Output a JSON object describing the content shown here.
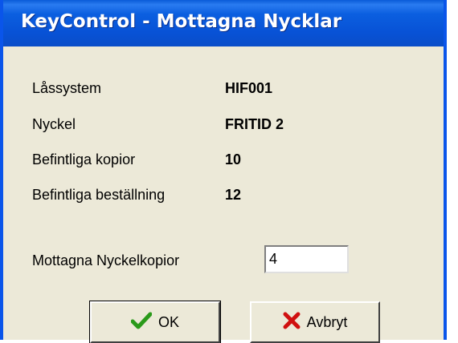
{
  "window": {
    "title": "KeyControl - Mottagna Nycklar"
  },
  "fields": {
    "lassystem_label": "Låssystem",
    "lassystem_value": "HIF001",
    "nyckel_label": "Nyckel",
    "nyckel_value": "FRITID 2",
    "befintliga_kopior_label": "Befintliga kopior",
    "befintliga_kopior_value": "10",
    "befintliga_bestallning_label": "Befintliga beställning",
    "befintliga_bestallning_value": "12",
    "mottagna_label": "Mottagna Nyckelkopior",
    "mottagna_value": "4"
  },
  "buttons": {
    "ok_label": "OK",
    "cancel_label": "Avbryt"
  },
  "icons": {
    "ok": "check-icon",
    "cancel": "x-icon"
  },
  "colors": {
    "titlebar": "#0a55ea",
    "dialog_bg": "#ece9d8",
    "check": "#2a9a1a",
    "x": "#d01010"
  }
}
